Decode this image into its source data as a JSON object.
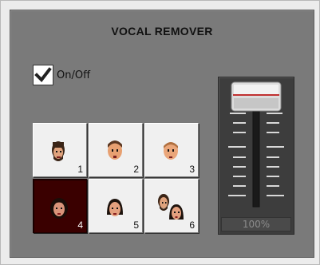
{
  "title": "VOCAL REMOVER",
  "toggle": {
    "label": "On/Off",
    "checked": true
  },
  "presets": [
    {
      "number": "1",
      "icon": "man-face-icon",
      "active": false
    },
    {
      "number": "2",
      "icon": "bald-man-face-icon",
      "active": false
    },
    {
      "number": "3",
      "icon": "older-man-face-icon",
      "active": false
    },
    {
      "number": "4",
      "icon": "woman-face-icon",
      "active": true
    },
    {
      "number": "5",
      "icon": "woman-long-hair-face-icon",
      "active": false
    },
    {
      "number": "6",
      "icon": "duet-faces-icon",
      "active": false
    }
  ],
  "slider": {
    "value_label": "100%",
    "value": 1.0
  },
  "colors": {
    "panel": "#7a7a7a",
    "active_preset": "#3a0000",
    "thumb_line": "#c03030"
  }
}
